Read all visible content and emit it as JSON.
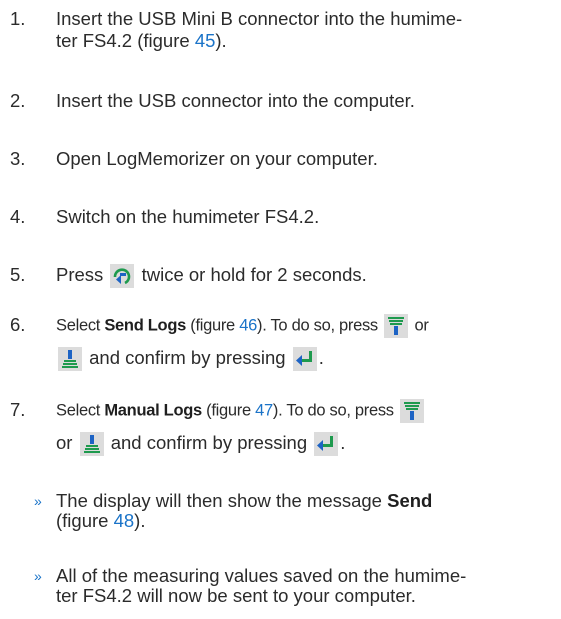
{
  "steps": [
    {
      "num": "1.",
      "text_a": "Insert the USB Mini B connector into the humime-",
      "text_b": "ter FS4.2 (figure ",
      "fig": "45",
      "text_c": ")."
    },
    {
      "num": "2.",
      "text": "Insert the USB connector into the computer."
    },
    {
      "num": "3.",
      "text": "Open LogMemorizer on your computer."
    },
    {
      "num": "4.",
      "text": "Switch on the humimeter FS4.2."
    },
    {
      "num": "5.",
      "text_a": "Press",
      "icon": "menu-arrow-icon",
      "text_b": "twice or hold for 2 seconds."
    },
    {
      "num": "6.",
      "text_a": "Select ",
      "bold": "Send Logs",
      "text_b": " (figure ",
      "fig": "46",
      "text_c": "). To do so, press",
      "text_d": "or",
      "text_e": "and confirm by pressing",
      "text_f": "."
    },
    {
      "num": "7.",
      "text_a": "Select ",
      "bold": "Manual Logs",
      "text_b": " (figure ",
      "fig": "47",
      "text_c": "). To do so, press",
      "text_d": "or",
      "text_e": "and confirm by pressing",
      "text_f": "."
    }
  ],
  "results": [
    {
      "chevron": "»",
      "text_a": "The display will then show the message ",
      "bold": "Send",
      "text_b": "(figure ",
      "fig": "48",
      "text_c": ")."
    },
    {
      "chevron": "»",
      "text_a": "All of the measuring values saved on the humime-",
      "text_b": "ter FS4.2 will now be sent to your computer."
    }
  ],
  "icons": {
    "down": "down-arrow-bars-icon",
    "up": "up-arrow-bars-icon",
    "enter": "enter-arrow-icon",
    "menu": "menu-arrow-icon"
  },
  "colors": {
    "link": "#1a73c8",
    "icon_blue": "#1d63c4",
    "icon_green": "#1e9a4e",
    "icon_bg": "#dcdcdc"
  }
}
